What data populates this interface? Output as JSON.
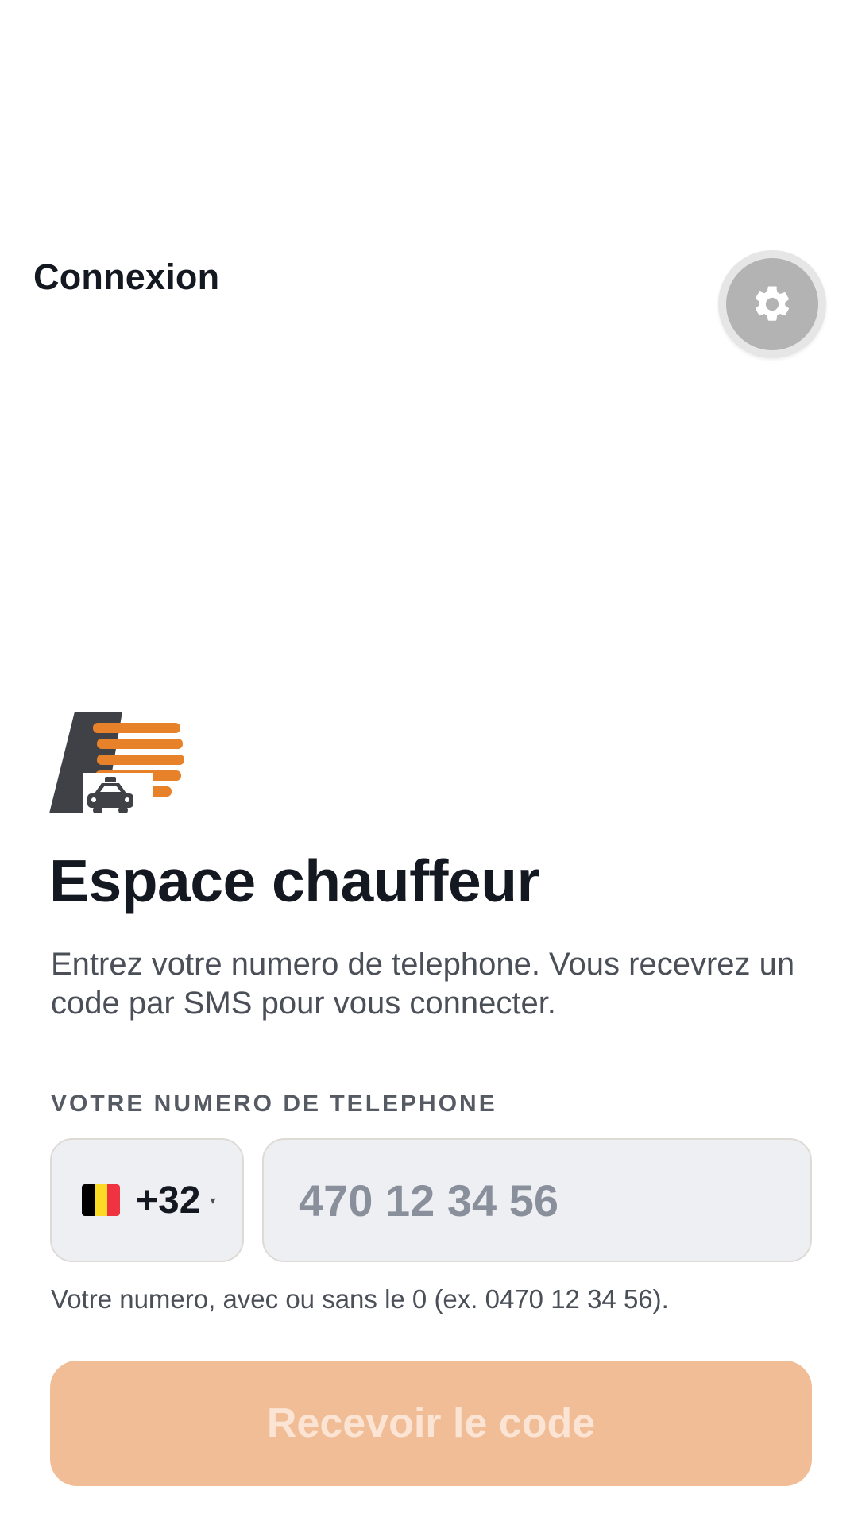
{
  "header": {
    "title": "Connexion",
    "settings_icon": "gear-icon"
  },
  "main": {
    "logo": "taxi-d-logo",
    "title": "Espace chauffeur",
    "description": "Entrez votre numero de telephone. Vous recevrez un code par SMS pour vous connecter.",
    "phone_label": "VOTRE NUMERO DE TELEPHONE",
    "country": {
      "flag": "belgium-flag",
      "dial_code": "+32",
      "caret": "▾"
    },
    "phone_input": {
      "value": "",
      "placeholder": "470 12 34 56"
    },
    "hint": "Votre numero, avec ou sans le 0 (ex. 0470 12 34 56).",
    "submit_label": "Recevoir le code"
  },
  "colors": {
    "accent": "#E8822A",
    "button_disabled": "#F0BD96",
    "text_primary": "#141821",
    "logo_dark": "#3F4147"
  }
}
